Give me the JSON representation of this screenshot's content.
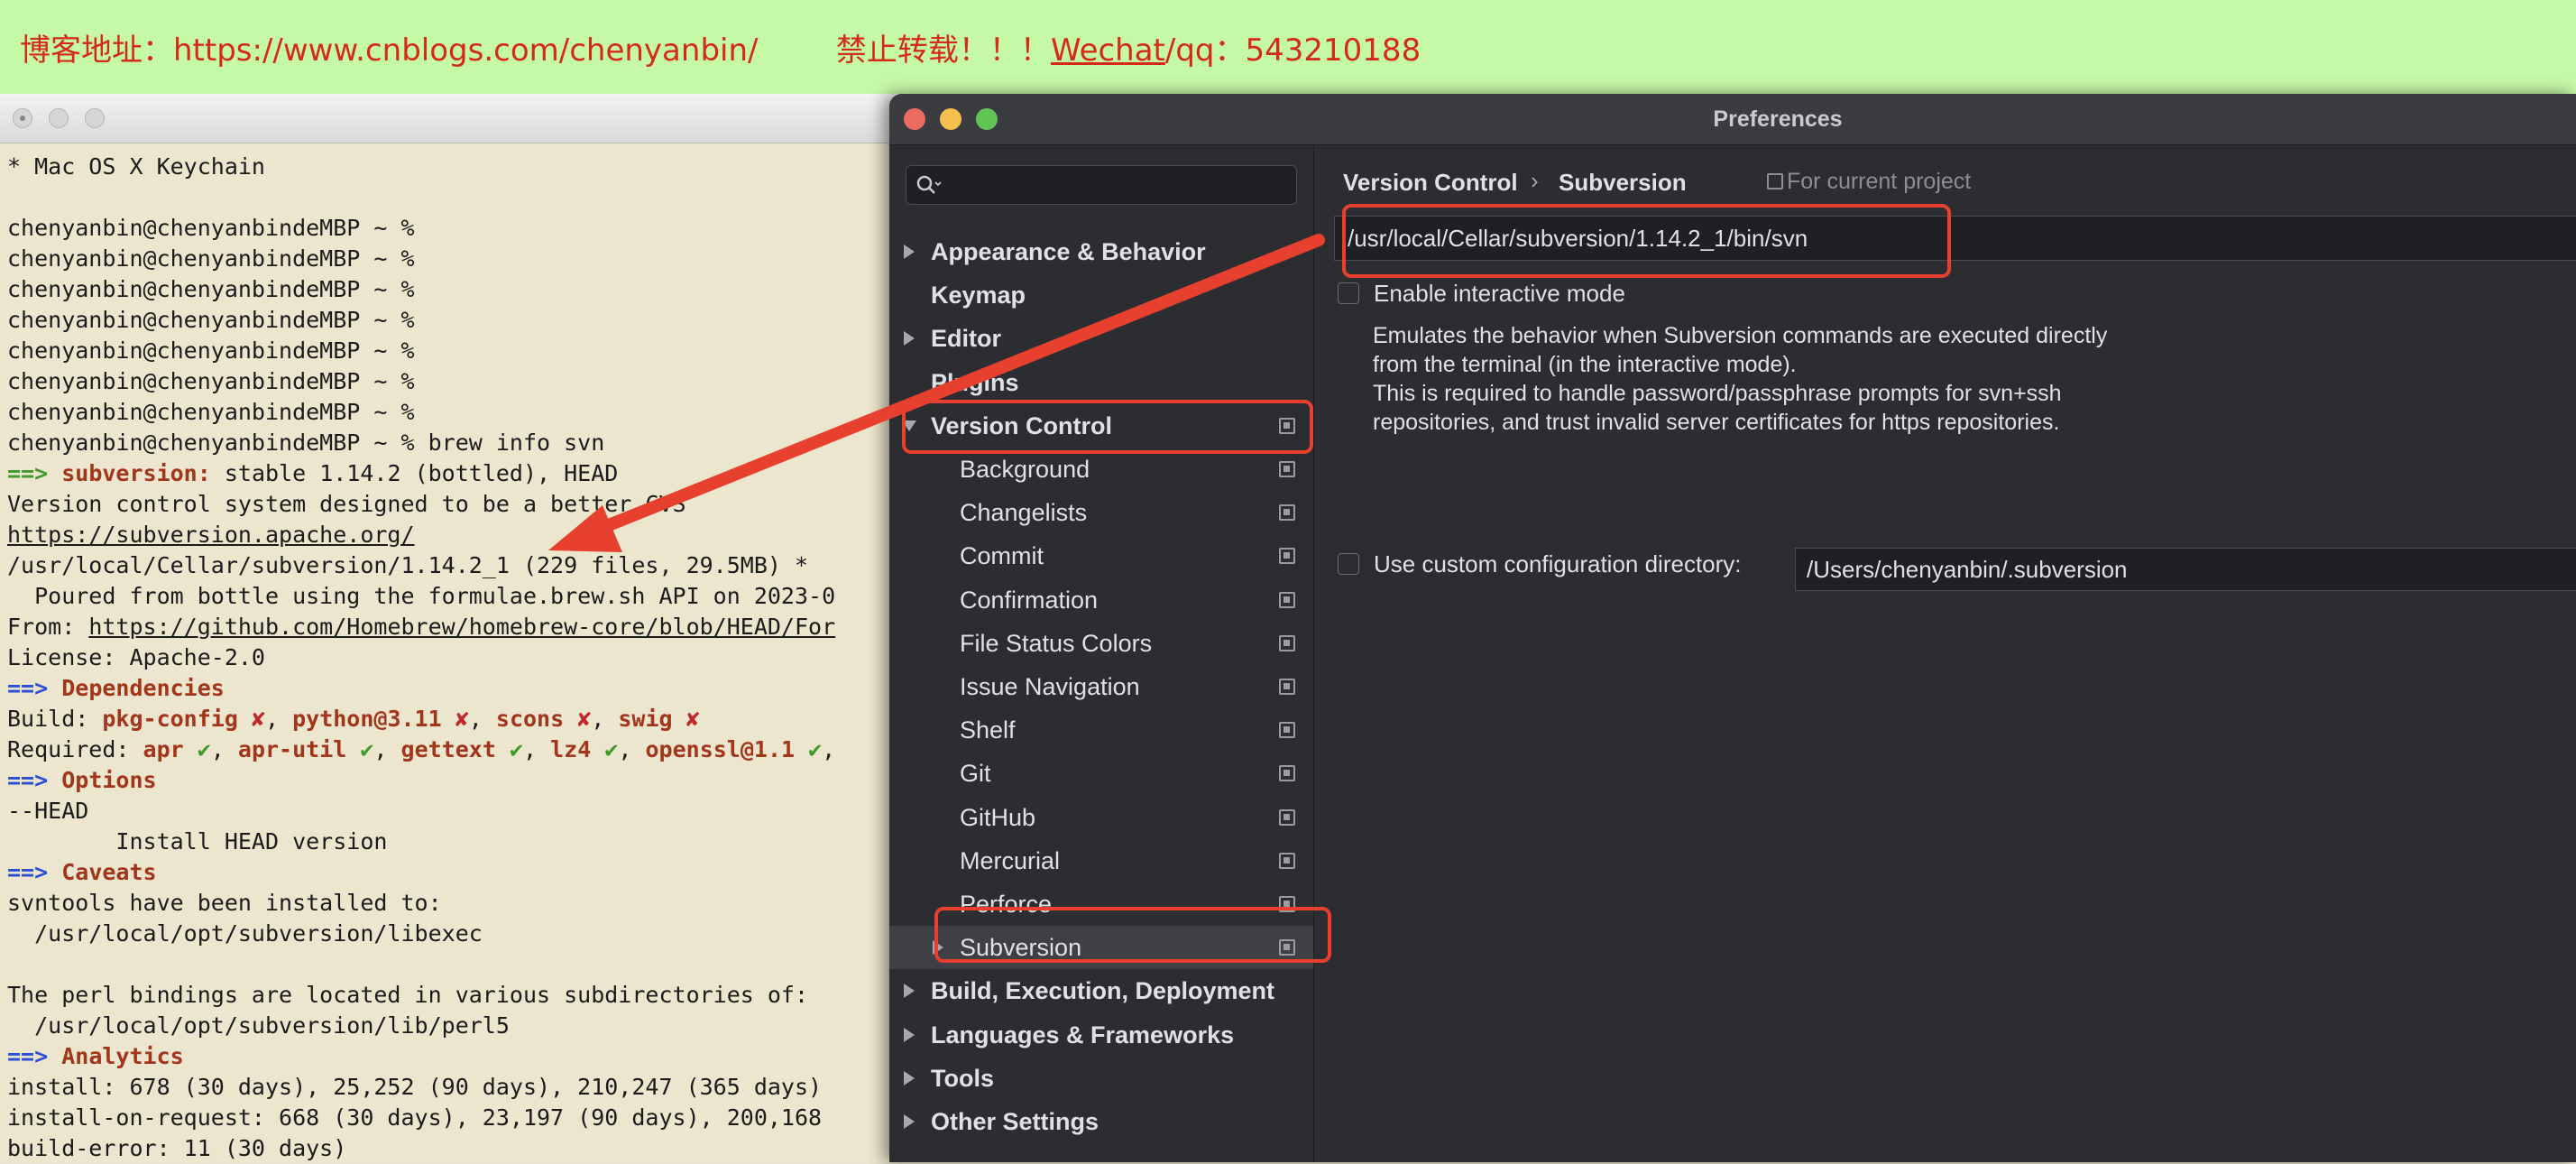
{
  "banner": {
    "text_prefix": "博客地址：https://www.cnblogs.com/chenyanbin/        禁止转载！！！",
    "wechat": "Wechat",
    "text_suffix": "/qq：543210188"
  },
  "terminal": {
    "lines": [
      [
        {
          "t": "* Mac OS X Keychain"
        }
      ],
      [
        {
          "t": ""
        }
      ],
      [
        {
          "t": "chenyanbin@chenyanbindeMBP ~ %"
        }
      ],
      [
        {
          "t": "chenyanbin@chenyanbindeMBP ~ %"
        }
      ],
      [
        {
          "t": "chenyanbin@chenyanbindeMBP ~ %"
        }
      ],
      [
        {
          "t": "chenyanbin@chenyanbindeMBP ~ %"
        }
      ],
      [
        {
          "t": "chenyanbin@chenyanbindeMBP ~ %"
        }
      ],
      [
        {
          "t": "chenyanbin@chenyanbindeMBP ~ %"
        }
      ],
      [
        {
          "t": "chenyanbin@chenyanbindeMBP ~ %"
        }
      ],
      [
        {
          "t": "chenyanbin@chenyanbindeMBP ~ % brew info svn"
        }
      ],
      [
        {
          "t": "==> ",
          "c": "ok"
        },
        {
          "t": "subversion:",
          "c": "hl"
        },
        {
          "t": " stable 1.14.2 (bottled), HEAD"
        }
      ],
      [
        {
          "t": "Version control system designed to be a better CVS"
        }
      ],
      [
        {
          "t": "https://subversion.apache.org/",
          "c": "u"
        }
      ],
      [
        {
          "t": "/usr/local/Cellar/subversion/1.14.2_1 (229 files, 29.5MB) *"
        }
      ],
      [
        {
          "t": "  Poured from bottle using the formulae.brew.sh API on 2023-0"
        }
      ],
      [
        {
          "t": "From: "
        },
        {
          "t": "https://github.com/Homebrew/homebrew-core/blob/HEAD/For",
          "c": "u"
        }
      ],
      [
        {
          "t": "License: Apache-2.0"
        }
      ],
      [
        {
          "t": "==> ",
          "c": "arrowp"
        },
        {
          "t": "Dependencies",
          "c": "hl"
        }
      ],
      [
        {
          "t": "Build: "
        },
        {
          "t": "pkg-config",
          "c": "hl"
        },
        {
          "t": " ✘",
          "c": "bad"
        },
        {
          "t": ", "
        },
        {
          "t": "python@3.11",
          "c": "hl"
        },
        {
          "t": " ✘",
          "c": "bad"
        },
        {
          "t": ", "
        },
        {
          "t": "scons",
          "c": "hl"
        },
        {
          "t": " ✘",
          "c": "bad"
        },
        {
          "t": ", "
        },
        {
          "t": "swig",
          "c": "hl"
        },
        {
          "t": " ✘",
          "c": "bad"
        }
      ],
      [
        {
          "t": "Required: "
        },
        {
          "t": "apr",
          "c": "hl"
        },
        {
          "t": " ✔",
          "c": "ok"
        },
        {
          "t": ", "
        },
        {
          "t": "apr-util",
          "c": "hl"
        },
        {
          "t": " ✔",
          "c": "ok"
        },
        {
          "t": ", "
        },
        {
          "t": "gettext",
          "c": "hl"
        },
        {
          "t": " ✔",
          "c": "ok"
        },
        {
          "t": ", "
        },
        {
          "t": "lz4",
          "c": "hl"
        },
        {
          "t": " ✔",
          "c": "ok"
        },
        {
          "t": ", "
        },
        {
          "t": "openssl@1.1",
          "c": "hl"
        },
        {
          "t": " ✔",
          "c": "ok"
        },
        {
          "t": ","
        }
      ],
      [
        {
          "t": "==> ",
          "c": "arrowp"
        },
        {
          "t": "Options",
          "c": "hl"
        }
      ],
      [
        {
          "t": "--HEAD"
        }
      ],
      [
        {
          "t": "        Install HEAD version"
        }
      ],
      [
        {
          "t": "==> ",
          "c": "arrowp"
        },
        {
          "t": "Caveats",
          "c": "hl"
        }
      ],
      [
        {
          "t": "svntools have been installed to:"
        }
      ],
      [
        {
          "t": "  /usr/local/opt/subversion/libexec"
        }
      ],
      [
        {
          "t": ""
        }
      ],
      [
        {
          "t": "The perl bindings are located in various subdirectories of:"
        }
      ],
      [
        {
          "t": "  /usr/local/opt/subversion/lib/perl5"
        }
      ],
      [
        {
          "t": "==> ",
          "c": "arrowp"
        },
        {
          "t": "Analytics",
          "c": "hl"
        }
      ],
      [
        {
          "t": "install: 678 (30 days), 25,252 (90 days), 210,247 (365 days)"
        }
      ],
      [
        {
          "t": "install-on-request: 668 (30 days), 23,197 (90 days), 200,168"
        }
      ],
      [
        {
          "t": "build-error: 11 (30 days)"
        }
      ]
    ]
  },
  "prefs": {
    "title": "Preferences",
    "search_placeholder": "",
    "nav": [
      {
        "label": "Appearance & Behavior",
        "level": 0,
        "arrow": "right",
        "copy": false
      },
      {
        "label": "Keymap",
        "level": 0,
        "arrow": "none",
        "copy": false
      },
      {
        "label": "Editor",
        "level": 0,
        "arrow": "right",
        "copy": false
      },
      {
        "label": "Plugins",
        "level": 0,
        "arrow": "none",
        "copy": false
      },
      {
        "label": "Version Control",
        "level": 0,
        "arrow": "down",
        "copy": true
      },
      {
        "label": "Background",
        "level": 1,
        "arrow": "none",
        "copy": true
      },
      {
        "label": "Changelists",
        "level": 1,
        "arrow": "none",
        "copy": true
      },
      {
        "label": "Commit",
        "level": 1,
        "arrow": "none",
        "copy": true
      },
      {
        "label": "Confirmation",
        "level": 1,
        "arrow": "none",
        "copy": true
      },
      {
        "label": "File Status Colors",
        "level": 1,
        "arrow": "none",
        "copy": true
      },
      {
        "label": "Issue Navigation",
        "level": 1,
        "arrow": "none",
        "copy": true
      },
      {
        "label": "Shelf",
        "level": 1,
        "arrow": "none",
        "copy": true
      },
      {
        "label": "Git",
        "level": 1,
        "arrow": "none",
        "copy": true
      },
      {
        "label": "GitHub",
        "level": 1,
        "arrow": "none",
        "copy": true
      },
      {
        "label": "Mercurial",
        "level": 1,
        "arrow": "none",
        "copy": true
      },
      {
        "label": "Perforce",
        "level": 1,
        "arrow": "none",
        "copy": true
      },
      {
        "label": "Subversion",
        "level": 1,
        "arrow": "right",
        "copy": true,
        "selected": true
      },
      {
        "label": "Build, Execution, Deployment",
        "level": 0,
        "arrow": "right",
        "copy": false
      },
      {
        "label": "Languages & Frameworks",
        "level": 0,
        "arrow": "right",
        "copy": false
      },
      {
        "label": "Tools",
        "level": 0,
        "arrow": "right",
        "copy": false
      },
      {
        "label": "Other Settings",
        "level": 0,
        "arrow": "right",
        "copy": false
      }
    ],
    "breadcrumb": {
      "parent": "Version Control",
      "sep": "›",
      "current": "Subversion"
    },
    "scope": "For current project",
    "svn_path": "/usr/local/Cellar/subversion/1.14.2_1/bin/svn",
    "interactive_label": "Enable interactive mode",
    "interactive_desc": [
      "Emulates the behavior when Subversion commands are executed directly",
      "from the terminal (in the interactive mode).",
      "This is required to handle password/passphrase prompts for svn+ssh",
      "repositories, and trust invalid server certificates for https repositories."
    ],
    "custom_config_label": "Use custom configuration directory:",
    "custom_config_path": "/Users/chenyanbin/.subversion"
  },
  "colors": {
    "annotation": "#e8402e",
    "banner_bg": "#c6f9a6",
    "banner_text": "#d42a17"
  }
}
